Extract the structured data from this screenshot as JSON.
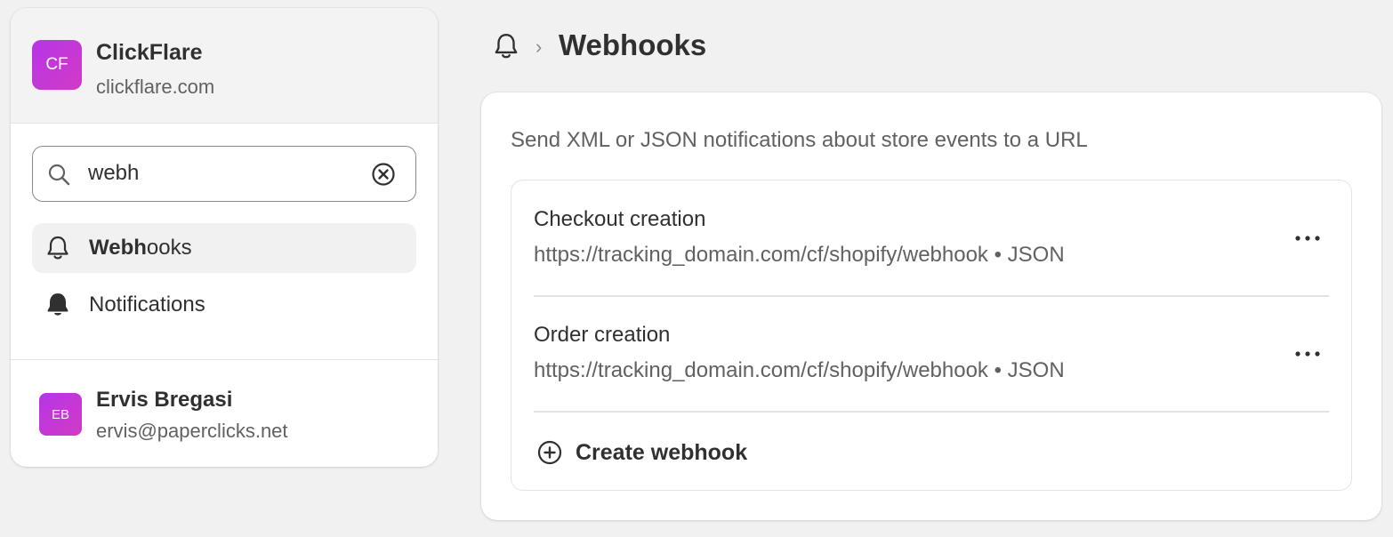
{
  "colors": {
    "avatar_gradient_start": "#b635e8",
    "avatar_gradient_end": "#d23bc4",
    "page_bg": "#f1f1f1",
    "card_bg": "#ffffff",
    "text_primary": "#303030",
    "text_secondary": "#616161"
  },
  "store": {
    "initials": "CF",
    "name": "ClickFlare",
    "domain": "clickflare.com"
  },
  "search": {
    "value": "webh",
    "icon": "search-icon",
    "clear_icon": "clear-circle-icon"
  },
  "nav": {
    "items": [
      {
        "label_match": "Webh",
        "label_rest": "ooks",
        "icon": "bell-outline-icon",
        "active": true
      },
      {
        "label_match": "",
        "label_rest": "Notifications",
        "icon": "bell-filled-icon",
        "active": false
      }
    ]
  },
  "user": {
    "initials": "EB",
    "name": "Ervis Bregasi",
    "email": "ervis@paperclicks.net"
  },
  "header": {
    "icon": "bell-outline-icon",
    "separator": "›",
    "title": "Webhooks"
  },
  "main": {
    "description": "Send XML or JSON notifications about store events to a URL",
    "webhooks": [
      {
        "title": "Checkout creation",
        "url": "https://tracking_domain.com/cf/shopify/webhook • JSON"
      },
      {
        "title": "Order creation",
        "url": "https://tracking_domain.com/cf/shopify/webhook • JSON"
      }
    ],
    "more_icon": "more-horizontal-icon",
    "create_label": "Create webhook",
    "create_icon": "plus-circle-icon"
  }
}
